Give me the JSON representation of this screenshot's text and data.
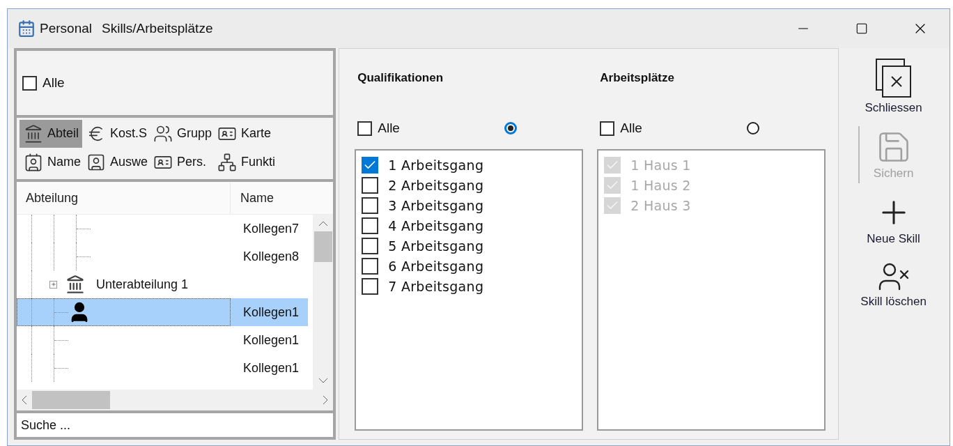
{
  "window": {
    "app": "Personal",
    "title": "Skills/Arbeitsplätze"
  },
  "filter": {
    "all": {
      "label": "Alle",
      "checked": false
    },
    "tabs": [
      {
        "label": "Abteil",
        "kind": "department",
        "selected": true
      },
      {
        "label": "Kost.S",
        "kind": "euro",
        "selected": false
      },
      {
        "label": "Grupp",
        "kind": "group",
        "selected": false
      },
      {
        "label": "Karte",
        "kind": "card",
        "selected": false
      },
      {
        "label": "Name",
        "kind": "namecard",
        "selected": false
      },
      {
        "label": "Auswe",
        "kind": "badge",
        "selected": false
      },
      {
        "label": "Pers.",
        "kind": "card",
        "selected": false
      },
      {
        "label": "Funkti",
        "kind": "network",
        "selected": false
      }
    ]
  },
  "tree": {
    "columns": [
      "Abteilung",
      "Name"
    ],
    "rows": [
      {
        "kind": "branch",
        "children": [
          {
            "kind": "person",
            "name": "Kollegen7",
            "selected": false
          },
          {
            "kind": "person",
            "name": "Kollegen8",
            "selected": false
          }
        ]
      },
      {
        "kind": "department",
        "label": "Unterabteilung 1",
        "expanded": false
      },
      {
        "kind": "person",
        "name": "Kollegen1",
        "selected": true
      },
      {
        "kind": "person",
        "name": "Kollegen1",
        "selected": false
      },
      {
        "kind": "person",
        "name": "Kollegen1",
        "selected": false
      }
    ]
  },
  "search": {
    "placeholder": "Suche ..."
  },
  "lists": [
    {
      "title": "Qualifikationen",
      "all": {
        "label": "Alle",
        "checked": false
      },
      "radio_selected": true,
      "items": [
        {
          "label": "1 Arbeitsgang",
          "checked": true,
          "disabled": false
        },
        {
          "label": "2 Arbeitsgang",
          "checked": false,
          "disabled": false
        },
        {
          "label": "3 Arbeitsgang",
          "checked": false,
          "disabled": false
        },
        {
          "label": "4 Arbeitsgang",
          "checked": false,
          "disabled": false
        },
        {
          "label": "5 Arbeitsgang",
          "checked": false,
          "disabled": false
        },
        {
          "label": "6 Arbeitsgang",
          "checked": false,
          "disabled": false
        },
        {
          "label": "7 Arbeitsgang",
          "checked": false,
          "disabled": false
        }
      ]
    },
    {
      "title": "Arbeitsplätze",
      "all": {
        "label": "Alle",
        "checked": false
      },
      "radio_selected": false,
      "items": [
        {
          "label": "1 Haus 1",
          "checked": true,
          "disabled": true
        },
        {
          "label": "1 Haus 2",
          "checked": true,
          "disabled": true
        },
        {
          "label": "2 Haus 3",
          "checked": true,
          "disabled": true
        }
      ]
    }
  ],
  "toolbar": [
    {
      "label": "Schliessen",
      "kind": "close",
      "disabled": false
    },
    {
      "label": "Sichern",
      "kind": "save",
      "disabled": true
    },
    {
      "label": "Neue Skill",
      "kind": "add",
      "disabled": false
    },
    {
      "label": "Skill löschen",
      "kind": "delete",
      "disabled": false
    }
  ]
}
